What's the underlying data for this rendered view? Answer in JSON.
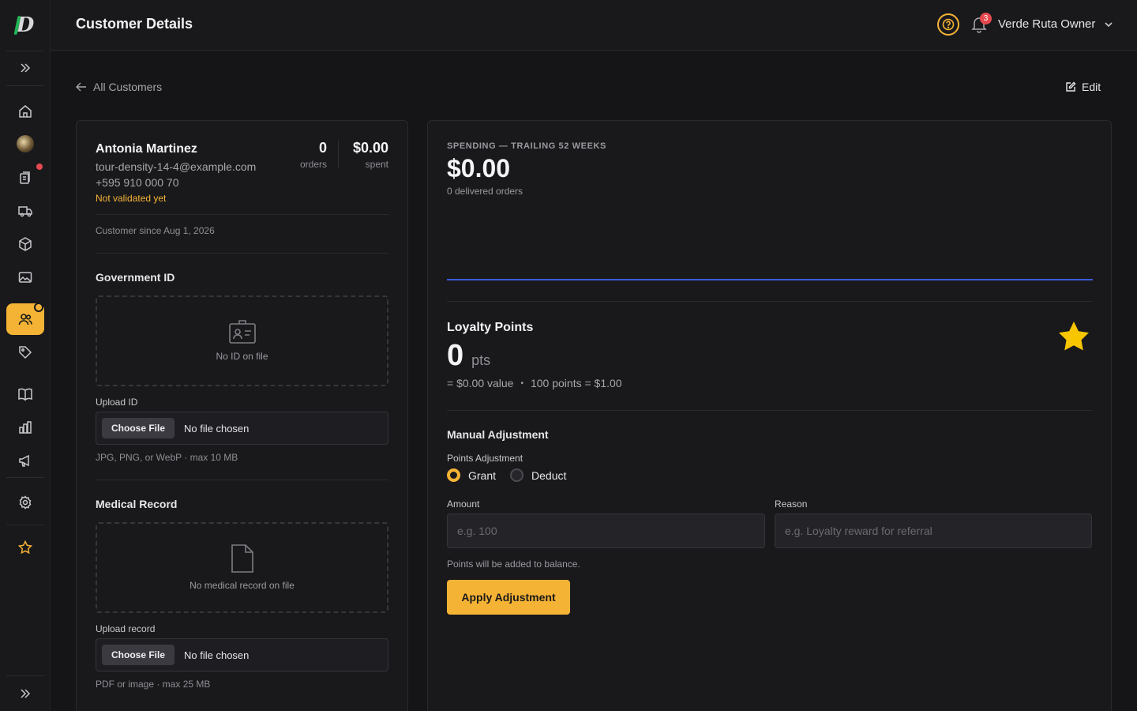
{
  "colors": {
    "accent": "#f5b335",
    "danger": "#e5484d",
    "chart_line": "#3b5bd9"
  },
  "header": {
    "title": "Customer Details",
    "notification_count": "3",
    "user_name": "Verde Ruta Owner"
  },
  "sidebar": {
    "items": [
      {
        "icon": "home-icon"
      },
      {
        "icon": "avatar-photo"
      },
      {
        "icon": "clipboard-icon"
      },
      {
        "icon": "truck-icon"
      },
      {
        "icon": "box-icon"
      },
      {
        "icon": "image-icon"
      },
      {
        "icon": "users-icon",
        "active": true
      },
      {
        "icon": "tag-icon"
      },
      {
        "icon": "book-icon"
      },
      {
        "icon": "chart-icon"
      },
      {
        "icon": "megaphone-icon"
      },
      {
        "icon": "gear-icon"
      },
      {
        "icon": "star-icon"
      }
    ]
  },
  "nav": {
    "back_label": "All Customers",
    "edit_label": "Edit"
  },
  "customer": {
    "name": "Antonia Martinez",
    "email": "tour-density-14-4@example.com",
    "phone": "+595 910 000 70",
    "status": "Not validated yet",
    "orders": "0",
    "orders_label": "orders",
    "spent": "$0.00",
    "spent_label": "spent",
    "since": "Customer since Aug 1, 2026"
  },
  "government_id": {
    "title": "Government ID",
    "empty": "No ID on file",
    "upload_label": "Upload ID",
    "button": "Choose File",
    "file_status": "No file chosen",
    "hint": "JPG, PNG, or WebP · max 10 MB"
  },
  "medical_record": {
    "title": "Medical Record",
    "empty": "No medical record on file",
    "upload_label": "Upload record",
    "button": "Choose File",
    "file_status": "No file chosen",
    "hint": "PDF or image · max 25 MB"
  },
  "spending": {
    "label": "SPENDING — TRAILING 52 WEEKS",
    "value": "$0.00",
    "sub": "0 delivered orders"
  },
  "loyalty": {
    "title": "Loyalty Points",
    "points": "0",
    "unit": "pts",
    "value_text": "= $0.00 value",
    "bullet": "•",
    "rate_text": "100 points = $1.00"
  },
  "adjustment": {
    "title": "Manual Adjustment",
    "sublabel": "Points Adjustment",
    "options": [
      "Grant",
      "Deduct"
    ],
    "selected": "Grant",
    "amount_label": "Amount",
    "amount_placeholder": "e.g. 100",
    "reason_label": "Reason",
    "reason_placeholder": "e.g. Loyalty reward for referral",
    "hint": "Points will be added to balance.",
    "button": "Apply Adjustment"
  }
}
